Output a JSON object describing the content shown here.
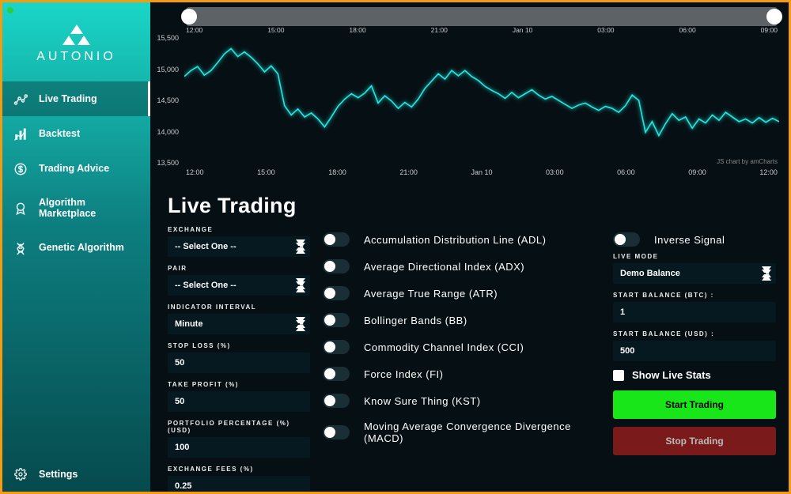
{
  "brand": "AUTONIO",
  "nav": [
    {
      "label": "Live Trading",
      "icon": "chart-line"
    },
    {
      "label": "Backtest",
      "icon": "bars"
    },
    {
      "label": "Trading Advice",
      "icon": "dollar"
    },
    {
      "label": "Algorithm Marketplace",
      "icon": "badge"
    },
    {
      "label": "Genetic Algorithm",
      "icon": "dna"
    }
  ],
  "settings_label": "Settings",
  "page_title": "Live Trading",
  "left": {
    "exchange": {
      "label": "EXCHANGE",
      "value": "-- Select One --"
    },
    "pair": {
      "label": "PAIR",
      "value": "-- Select One --"
    },
    "indicator_interval": {
      "label": "INDICATOR INTERVAL",
      "value": "Minute"
    },
    "stop_loss": {
      "label": "STOP LOSS (%)",
      "value": "50"
    },
    "take_profit": {
      "label": "TAKE PROFIT (%)",
      "value": "50"
    },
    "portfolio_pct": {
      "label": "PORTFOLIO PERCENTAGE (%) (USD)",
      "value": "100"
    },
    "exchange_fees": {
      "label": "EXCHANGE FEES (%)",
      "value": "0.25"
    }
  },
  "indicators": [
    "Accumulation Distribution Line (ADL)",
    "Average Directional Index (ADX)",
    "Average True Range (ATR)",
    "Bollinger Bands (BB)",
    "Commodity Channel Index (CCI)",
    "Force Index (FI)",
    "Know Sure Thing (KST)",
    "Moving Average Convergence Divergence (MACD)"
  ],
  "right": {
    "inverse_signal": "Inverse Signal",
    "live_mode": {
      "label": "LIVE MODE",
      "value": "Demo Balance"
    },
    "start_btc": {
      "label": "START BALANCE (BTC) :",
      "value": "1"
    },
    "start_usd": {
      "label": "START BALANCE (USD) :",
      "value": "500"
    },
    "show_live_stats": "Show Live Stats",
    "start_btn": "Start Trading",
    "stop_btn": "Stop Trading"
  },
  "chart_data": {
    "type": "line",
    "title": "",
    "xlabel": "",
    "ylabel": "",
    "ylim": [
      13500,
      15500
    ],
    "x_ticks": [
      "12:00",
      "15:00",
      "18:00",
      "21:00",
      "Jan 10",
      "03:00",
      "06:00",
      "09:00",
      "12:00"
    ],
    "timeline_ticks": [
      "12:00",
      "15:00",
      "18:00",
      "21:00",
      "Jan 10",
      "03:00",
      "06:00",
      "09:00"
    ],
    "credit": "JS chart by amCharts",
    "values": [
      14860,
      14950,
      15010,
      14880,
      14950,
      15070,
      15200,
      15280,
      15160,
      15230,
      15150,
      15050,
      14930,
      15020,
      14900,
      14420,
      14280,
      14370,
      14250,
      14310,
      14220,
      14100,
      14250,
      14410,
      14520,
      14600,
      14540,
      14610,
      14720,
      14460,
      14570,
      14490,
      14380,
      14470,
      14400,
      14520,
      14680,
      14790,
      14900,
      14820,
      14950,
      14870,
      14950,
      14860,
      14800,
      14710,
      14650,
      14600,
      14530,
      14620,
      14540,
      14600,
      14660,
      14580,
      14520,
      14560,
      14500,
      14440,
      14380,
      14430,
      14460,
      14400,
      14350,
      14410,
      14380,
      14320,
      14420,
      14580,
      14500,
      14020,
      14180,
      13970,
      14150,
      14300,
      14200,
      14250,
      14080,
      14220,
      14160,
      14280,
      14200,
      14320,
      14250,
      14180,
      14220,
      14160,
      14240,
      14170,
      14230,
      14180
    ]
  }
}
